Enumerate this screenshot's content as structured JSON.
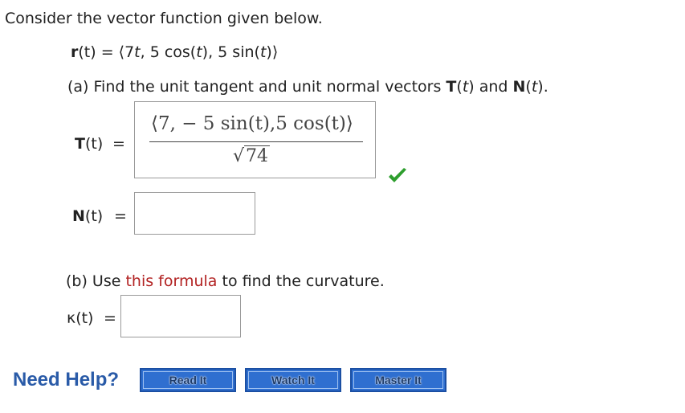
{
  "intro": "Consider the vector function given below.",
  "function_def": {
    "lhs_name": "r",
    "lhs_arg": "(t) = ",
    "open": "⟨",
    "c1": "7",
    "c1_var": "t",
    "sep1": ", 5 cos(",
    "c2_var": "t",
    "sep2": "), 5 sin(",
    "c3_var": "t",
    "close_paren": ")",
    "close": "⟩"
  },
  "part_a": {
    "prefix": "(a) Find the unit tangent and unit normal vectors ",
    "T": "T",
    "T_arg_open": "(",
    "T_var": "t",
    "T_arg_close": ") and ",
    "N": "N",
    "N_arg_open": "(",
    "N_var": "t",
    "N_arg_close": ")."
  },
  "T_answer": {
    "label_name": "T",
    "label_arg": "(t)",
    "equals": "=",
    "numerator": "⟨7, − 5 sin(t),5 cos(t)⟩",
    "radical": "√",
    "denominator": "74",
    "status": "correct"
  },
  "N_answer": {
    "label_name": "N",
    "label_arg": "(t)",
    "equals": "=",
    "value": ""
  },
  "part_b": {
    "prefix": "(b) Use ",
    "link": "this formula",
    "suffix": " to find the curvature."
  },
  "kappa_answer": {
    "label": "κ(t)",
    "equals": "=",
    "value": ""
  },
  "help": {
    "title": "Need Help?",
    "buttons": [
      "Read It",
      "Watch It",
      "Master It"
    ]
  },
  "colors": {
    "check": "#2e9e2e",
    "link": "#b22222",
    "help_title": "#2a5ba8",
    "button_face": "#2f6fd0"
  }
}
